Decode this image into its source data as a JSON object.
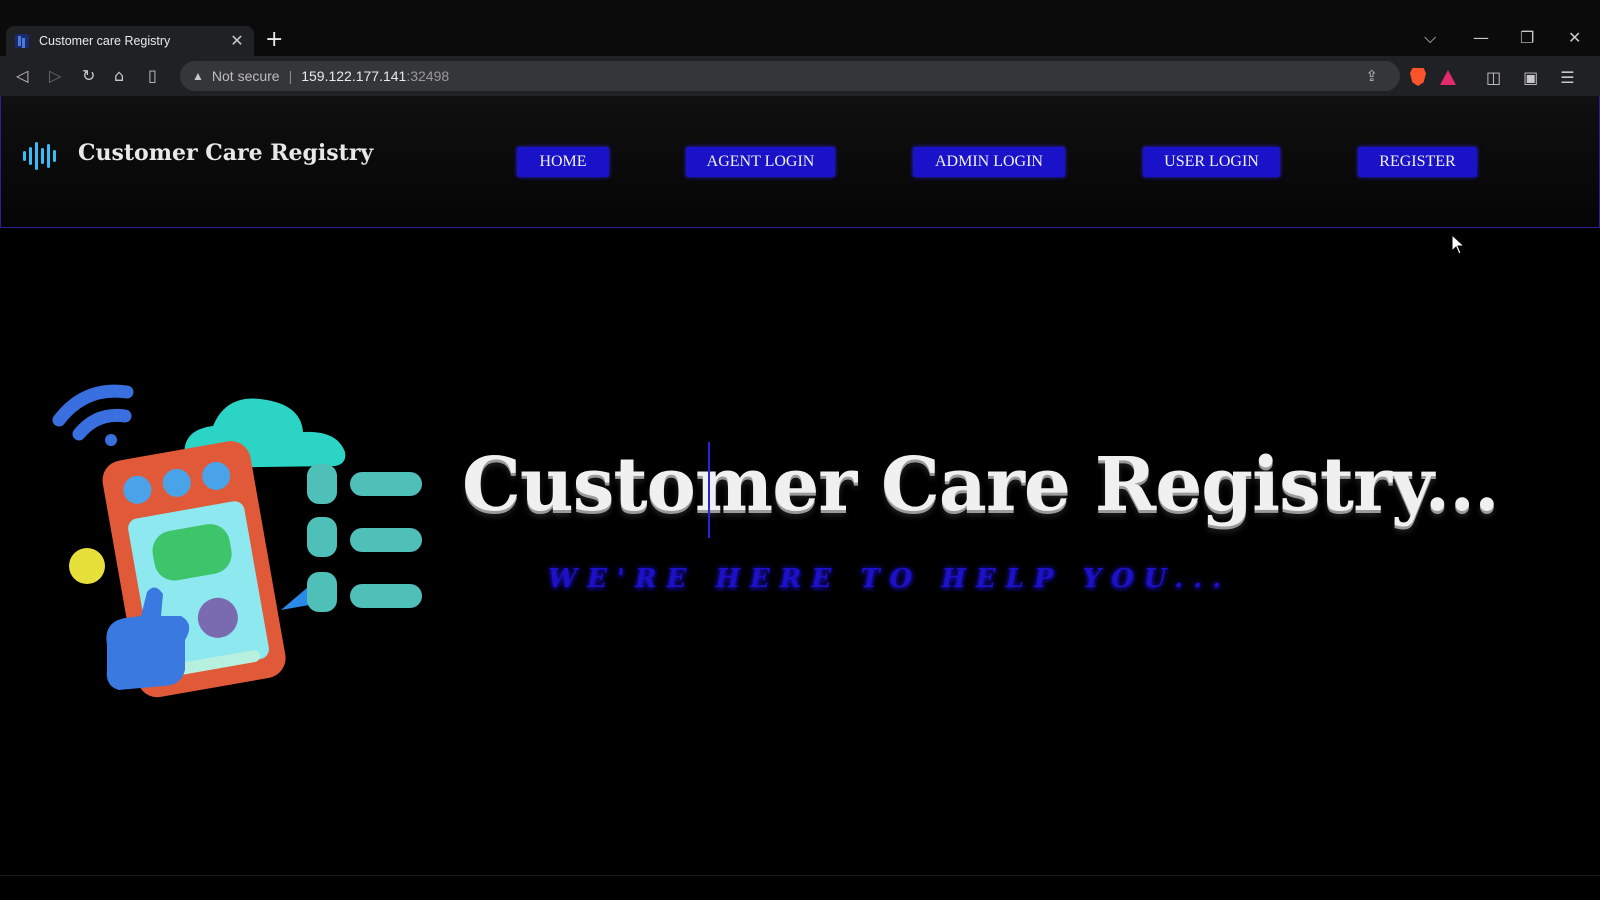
{
  "browser": {
    "tab_title": "Customer care Registry",
    "tab_close": "✕",
    "new_tab": "+",
    "not_secure": "Not secure",
    "url_host": "159.122.177.141",
    "url_port": ":32498",
    "icons": [
      "back-icon",
      "forward-icon",
      "reload-icon",
      "home-icon",
      "bookmark-icon",
      "warning-icon",
      "share-icon",
      "brave-shields-icon",
      "brave-rewards-icon",
      "sidebar-icon",
      "wallet-icon",
      "menu-icon",
      "tab-search-icon",
      "minimize-icon",
      "restore-icon",
      "window-close-icon"
    ]
  },
  "header": {
    "brand": "Customer Care Registry",
    "nav": [
      {
        "label": "HOME"
      },
      {
        "label": "AGENT LOGIN"
      },
      {
        "label": "ADMIN LOGIN"
      },
      {
        "label": "USER LOGIN"
      },
      {
        "label": "REGISTER"
      }
    ]
  },
  "hero": {
    "title": "Customer Care Registry...",
    "subtitle": "WE'RE HERE TO HELP YOU..."
  },
  "colors": {
    "accent": "#1a12c8",
    "logo": "#38bdf8",
    "background": "#000000"
  }
}
